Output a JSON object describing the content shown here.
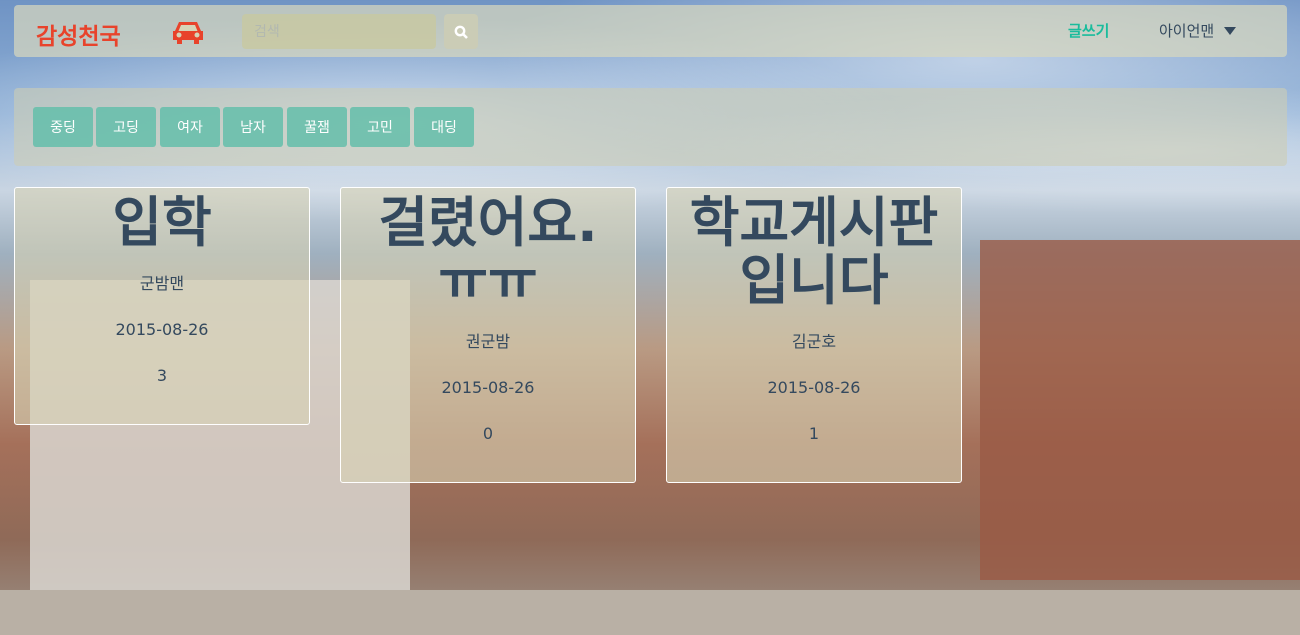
{
  "navbar": {
    "brand": "감성천국",
    "brand_icon": "car-icon",
    "search_placeholder": "검색",
    "search_icon": "search-icon",
    "write_label": "글쓰기",
    "user_label": "아이언맨",
    "colors": {
      "brand": "#e8432b",
      "accent": "#1abc9c",
      "text": "#34495e"
    }
  },
  "categories": [
    "중딩",
    "고딩",
    "여자",
    "남자",
    "꿀잼",
    "고민",
    "대딩"
  ],
  "posts": [
    {
      "title": "입학",
      "author": "군밤맨",
      "date": "2015-08-26",
      "count": "3"
    },
    {
      "title": "걸렸어요.ㅠㅠ",
      "author": "권군밤",
      "date": "2015-08-26",
      "count": "0"
    },
    {
      "title": "학교게시판 입니다",
      "author": "김군호",
      "date": "2015-08-26",
      "count": "1"
    }
  ]
}
